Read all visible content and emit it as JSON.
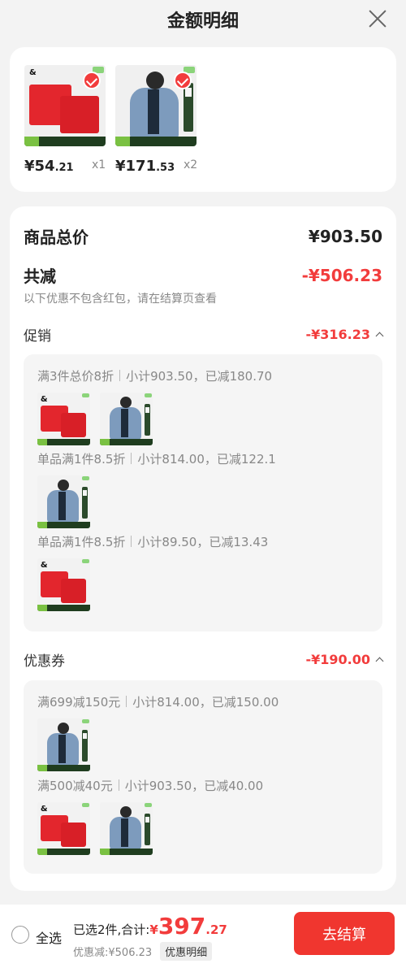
{
  "header": {
    "title": "金额明细"
  },
  "products": [
    {
      "price_int": "¥54",
      "price_dec": ".21",
      "qty": "x1",
      "kind": "shorts"
    },
    {
      "price_int": "¥171",
      "price_dec": ".53",
      "qty": "x2",
      "kind": "man"
    }
  ],
  "summary": {
    "total_label": "商品总价",
    "total_value": "¥903.50",
    "reduce_label": "共减",
    "reduce_value": "-¥506.23",
    "note": "以下优惠不包含红包，请在结算页查看"
  },
  "promo": {
    "label": "促销",
    "value": "-¥316.23",
    "rules": [
      {
        "name": "满3件总价8折",
        "detail": "小计903.50，已减180.70"
      },
      {
        "name": "单品满1件8.5折",
        "detail": "小计814.00，已减122.1"
      },
      {
        "name": "单品满1件8.5折",
        "detail": "小计89.50，已减13.43"
      }
    ]
  },
  "coupon": {
    "label": "优惠券",
    "value": "-¥190.00",
    "rules": [
      {
        "name": "满699减150元",
        "detail": "小计814.00，已减150.00"
      },
      {
        "name": "满500减40元",
        "detail": "小计903.50，已减40.00"
      }
    ]
  },
  "bottom": {
    "select_all": "全选",
    "selected_text": "已选2件,合计:",
    "currency": "¥",
    "amount_int": "397",
    "amount_dec": ".27",
    "discount_text": "优惠减:¥506.23",
    "detail_button": "优惠明细",
    "checkout": "去结算"
  },
  "colors": {
    "accent": "#f23c3c",
    "checkout": "#f0362f"
  }
}
